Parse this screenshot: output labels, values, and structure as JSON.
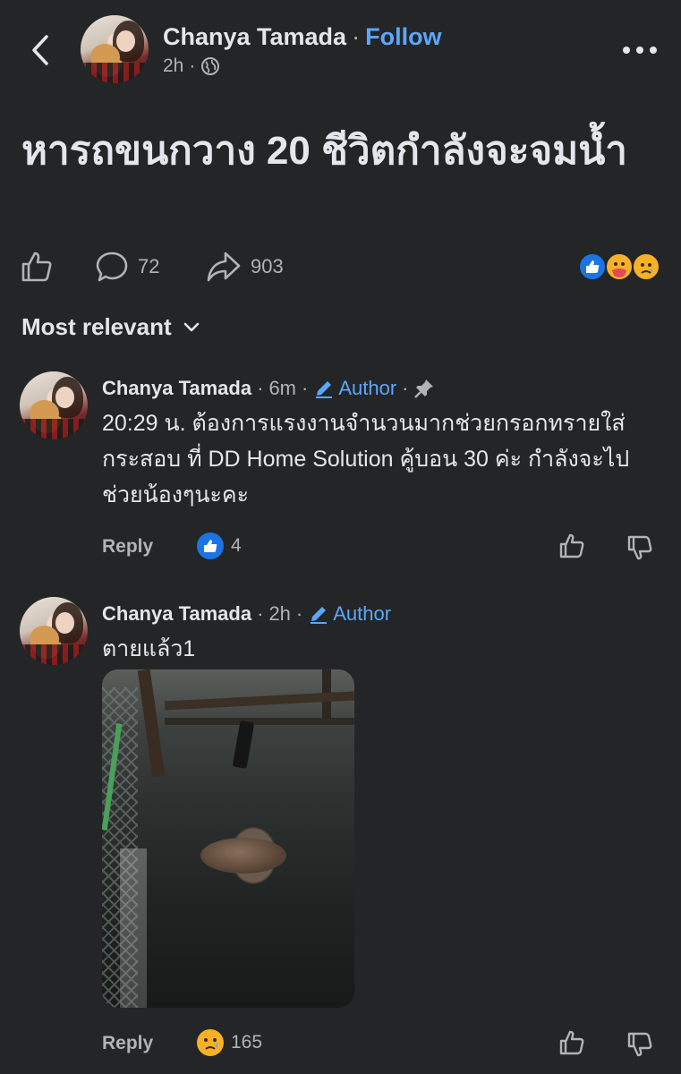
{
  "header": {
    "author_name": "Chanya Tamada",
    "separator": "·",
    "follow_label": "Follow",
    "timestamp": "2h",
    "audience_icon": "globe-icon"
  },
  "post": {
    "text": "หารถขนกวาง 20 ชีวิตกำลังจะจมน้ำ",
    "comment_count": "72",
    "share_count": "903",
    "reactions": [
      "like",
      "care",
      "sad"
    ]
  },
  "sort": {
    "label": "Most relevant"
  },
  "comments": [
    {
      "author": "Chanya Tamada",
      "time": "6m",
      "badge": "Author",
      "pinned": true,
      "body": "20:29 น. ต้องการแรงงานจำนวนมากช่วยกรอกทรายใส่กระสอบ ที่ DD Home Solution คู้บอน 30 ค่ะ กำลังจะไปช่วยน้องๆนะคะ",
      "reply_label": "Reply",
      "reaction": "like",
      "reaction_count": "4"
    },
    {
      "author": "Chanya Tamada",
      "time": "2h",
      "badge": "Author",
      "pinned": false,
      "body": "ตายแล้ว1",
      "reply_label": "Reply",
      "reaction": "sad",
      "reaction_count": "165"
    }
  ],
  "colors": {
    "background": "#242526",
    "text": "#e4e6eb",
    "muted": "#b0b3b8",
    "accent": "#5aa7ff",
    "like_blue": "#1b74e4",
    "reaction_yellow": "#f7b125"
  }
}
